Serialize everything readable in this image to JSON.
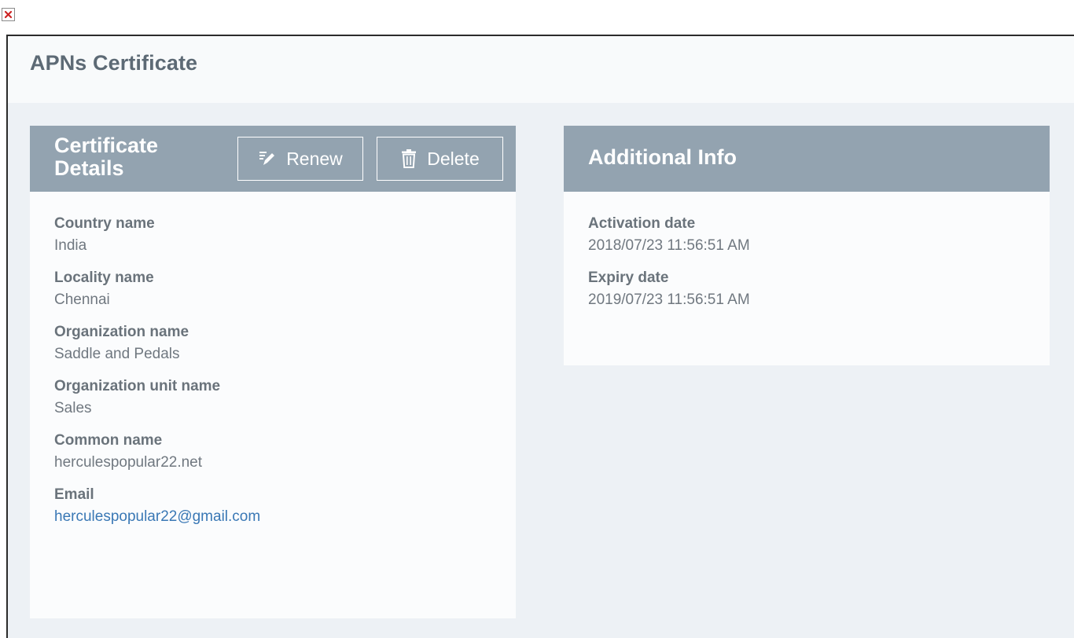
{
  "dialog": {
    "title": "APNs Certificate"
  },
  "certificate_details": {
    "title": "Certificate Details",
    "renew_label": "Renew",
    "delete_label": "Delete",
    "fields": [
      {
        "label": "Country name",
        "value": "India"
      },
      {
        "label": "Locality name",
        "value": "Chennai"
      },
      {
        "label": "Organization name",
        "value": "Saddle and Pedals"
      },
      {
        "label": "Organization unit name",
        "value": "Sales"
      },
      {
        "label": "Common name",
        "value": "herculespopular22.net"
      },
      {
        "label": "Email",
        "value": "herculespopular22@gmail.com"
      }
    ]
  },
  "additional_info": {
    "title": "Additional Info",
    "fields": [
      {
        "label": "Activation date",
        "value": "2018/07/23 11:56:51 AM"
      },
      {
        "label": "Expiry date",
        "value": "2019/07/23 11:56:51 AM"
      }
    ]
  },
  "icons": {
    "close": "close-icon",
    "renew": "edit-pencil-icon",
    "delete": "trash-icon"
  },
  "colors": {
    "card_header": "#93a3b0",
    "background": "#edf1f5",
    "link": "#3a78b5",
    "close_x": "#cc2222"
  }
}
